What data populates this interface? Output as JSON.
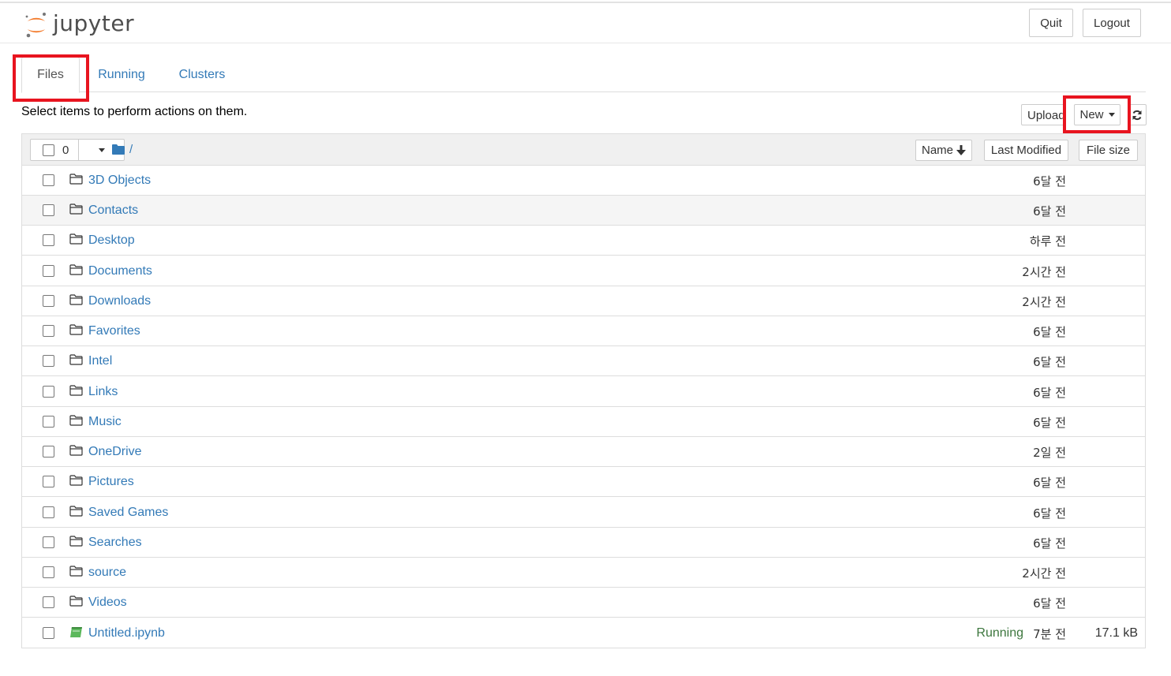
{
  "header": {
    "logo_text": "jupyter",
    "quit_label": "Quit",
    "logout_label": "Logout"
  },
  "tabs": [
    {
      "label": "Files",
      "active": true
    },
    {
      "label": "Running",
      "active": false
    },
    {
      "label": "Clusters",
      "active": false
    }
  ],
  "toolbar": {
    "instructions": "Select items to perform actions on them.",
    "upload_label": "Upload",
    "new_label": "New",
    "refresh_icon": "refresh-icon"
  },
  "list_header": {
    "selected_count": "0",
    "breadcrumb": "/",
    "sort_name": "Name",
    "sort_modified": "Last Modified",
    "sort_size": "File size"
  },
  "items": [
    {
      "name": "3D Objects",
      "type": "folder",
      "modified": "6달 전"
    },
    {
      "name": "Contacts",
      "type": "folder",
      "modified": "6달 전"
    },
    {
      "name": "Desktop",
      "type": "folder",
      "modified": "하루 전"
    },
    {
      "name": "Documents",
      "type": "folder",
      "modified": "2시간 전"
    },
    {
      "name": "Downloads",
      "type": "folder",
      "modified": "2시간 전"
    },
    {
      "name": "Favorites",
      "type": "folder",
      "modified": "6달 전"
    },
    {
      "name": "Intel",
      "type": "folder",
      "modified": "6달 전"
    },
    {
      "name": "Links",
      "type": "folder",
      "modified": "6달 전"
    },
    {
      "name": "Music",
      "type": "folder",
      "modified": "6달 전"
    },
    {
      "name": "OneDrive",
      "type": "folder",
      "modified": "2일 전"
    },
    {
      "name": "Pictures",
      "type": "folder",
      "modified": "6달 전"
    },
    {
      "name": "Saved Games",
      "type": "folder",
      "modified": "6달 전"
    },
    {
      "name": "Searches",
      "type": "folder",
      "modified": "6달 전"
    },
    {
      "name": "source",
      "type": "folder",
      "modified": "2시간 전"
    },
    {
      "name": "Videos",
      "type": "folder",
      "modified": "6달 전"
    },
    {
      "name": "Untitled.ipynb",
      "type": "notebook",
      "modified": "7분 전",
      "status": "Running",
      "size": "17.1 kB"
    }
  ],
  "colors": {
    "link": "#337ab7",
    "running": "#3c763d",
    "highlight": "#e8141f",
    "logo_orange": "#f37726"
  }
}
